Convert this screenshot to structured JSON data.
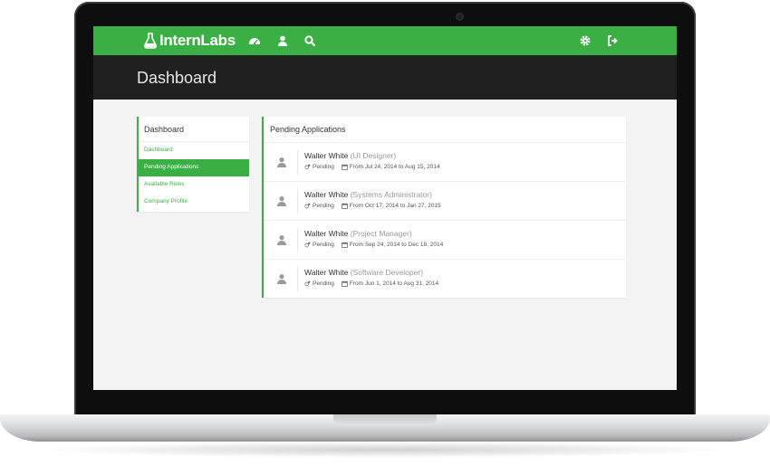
{
  "navbar": {
    "brand": "InternLabs",
    "left_icons": [
      "dashboard-icon",
      "user-icon",
      "search-icon"
    ],
    "right_icons": [
      "gear-icon",
      "sign-out-icon"
    ],
    "color": "#3aaf43"
  },
  "header": {
    "title": "Dashboard"
  },
  "sidebar": {
    "title": "Dashboard",
    "items": [
      {
        "label": "Dashboard",
        "active": false
      },
      {
        "label": "Pending Applications",
        "active": true
      },
      {
        "label": "Available Roles",
        "active": false
      },
      {
        "label": "Company Profile",
        "active": false
      }
    ]
  },
  "panel": {
    "title": "Pending Applications",
    "applications": [
      {
        "name": "Walter White",
        "role": "(UI Designer)",
        "status": "Pending",
        "dates": "From Jul 24, 2014 to Aug 15, 2014"
      },
      {
        "name": "Walter White",
        "role": "(Systems Administrator)",
        "status": "Pending",
        "dates": "From Oct 17, 2014 to Jan 27, 2015"
      },
      {
        "name": "Walter White",
        "role": "(Project Manager)",
        "status": "Pending",
        "dates": "From Sep 24, 2014 to Dec 18, 2014"
      },
      {
        "name": "Walter White",
        "role": "(Software Developer)",
        "status": "Pending",
        "dates": "From Jun 1, 2014 to Aug 31, 2014"
      }
    ]
  }
}
